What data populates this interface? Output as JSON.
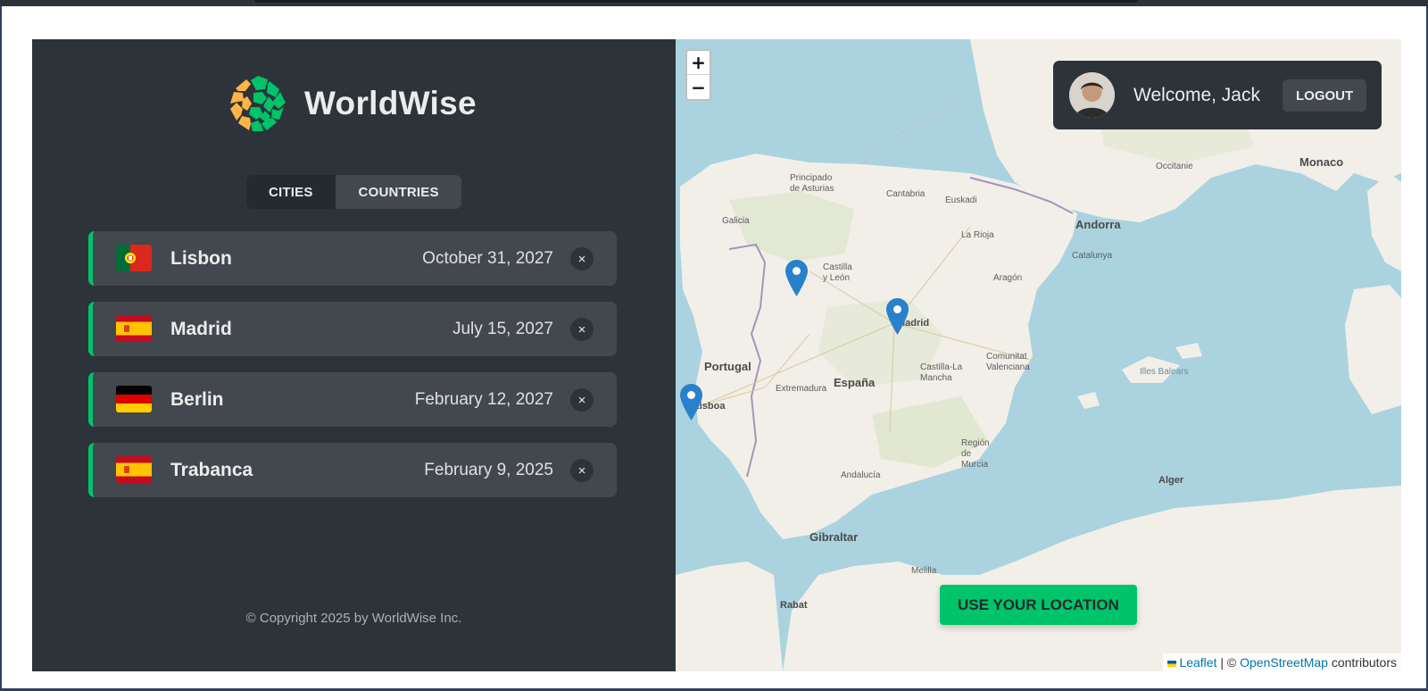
{
  "app": {
    "name": "WorldWise",
    "copyright": "© Copyright 2025 by WorldWise Inc."
  },
  "tabs": [
    {
      "label": "CITIES",
      "active": true
    },
    {
      "label": "COUNTRIES",
      "active": false
    }
  ],
  "cities": [
    {
      "name": "Lisbon",
      "date": "October 31, 2027",
      "flag": "portugal",
      "delete": "×"
    },
    {
      "name": "Madrid",
      "date": "July 15, 2027",
      "flag": "spain",
      "delete": "×"
    },
    {
      "name": "Berlin",
      "date": "February 12, 2027",
      "flag": "germany",
      "delete": "×"
    },
    {
      "name": "Trabanca",
      "date": "February 9, 2025",
      "flag": "spain",
      "delete": "×"
    }
  ],
  "map": {
    "zoom_in": "+",
    "zoom_out": "−",
    "use_location": "USE YOUR LOCATION",
    "attribution": {
      "leaflet": "Leaflet",
      "separator": " | © ",
      "osm": "OpenStreetMap",
      "contributors": " contributors"
    },
    "labels": {
      "portugal": "Portugal",
      "espana": "España",
      "madrid": "Madrid",
      "lisboa": "Lisboa",
      "andorra": "Andorra",
      "monaco": "Monaco",
      "gibraltar": "Gibraltar",
      "alger": "Alger",
      "rabat": "Rabat",
      "galicia": "Galicia",
      "principado": "Principado de Asturias",
      "cantabria": "Cantabria",
      "castilla_leon": "Castilla y León",
      "aragon": "Aragón",
      "catalunya": "Catalunya",
      "extremadura": "Extremadura",
      "castilla_mancha": "Castilla-La Mancha",
      "comunitat": "Comunitat Valenciana",
      "andalucia": "Andalucía",
      "murcia": "Región de Murcia",
      "illes": "Illes Balears",
      "occitanie": "Occitanie",
      "la_rioja": "La Rioja",
      "euskadi": "Euskadi",
      "melilla": "Melilla"
    }
  },
  "user": {
    "welcome": "Welcome, Jack",
    "logout": "LOGOUT"
  },
  "colors": {
    "brand_green": "#00c46a",
    "brand_yellow": "#ffb545",
    "sidebar_bg": "#2d3439",
    "item_bg": "#42484d",
    "sea": "#aad3df"
  }
}
